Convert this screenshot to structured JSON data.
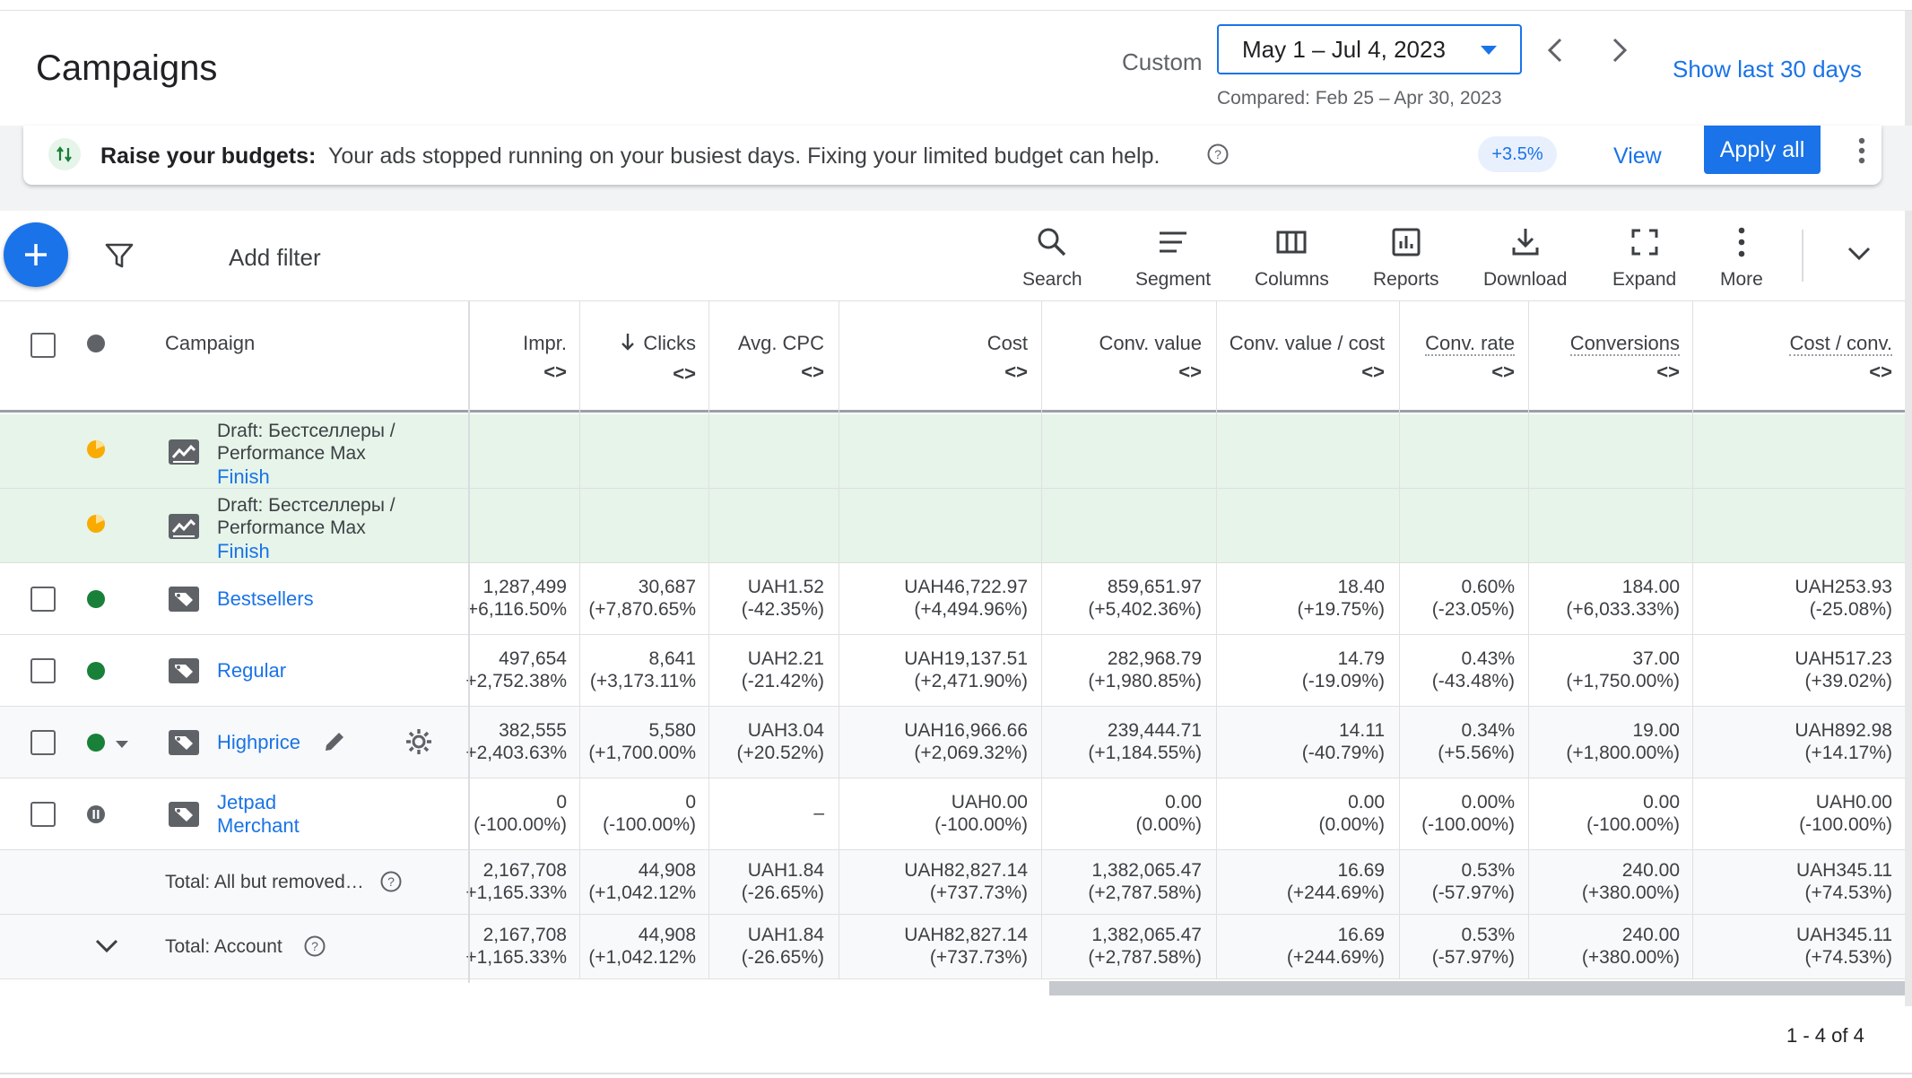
{
  "header": {
    "title": "Campaigns",
    "custom_label": "Custom",
    "date_range": "May 1 – Jul 4, 2023",
    "compared": "Compared: Feb 25 – Apr 30, 2023",
    "show_last": "Show last 30 days"
  },
  "banner": {
    "title": "Raise your budgets:",
    "text": "Your ads stopped running on your busiest days. Fixing your limited budget can help.",
    "chip": "+3.5%",
    "view": "View",
    "apply": "Apply all"
  },
  "toolbar": {
    "add_filter": "Add filter",
    "tools": [
      "Search",
      "Segment",
      "Columns",
      "Reports",
      "Download",
      "Expand",
      "More"
    ]
  },
  "table": {
    "headers": {
      "campaign": "Campaign",
      "impr": "Impr.",
      "clicks": "Clicks",
      "avg_cpc": "Avg. CPC",
      "cost": "Cost",
      "conv_value": "Conv. value",
      "conv_value_cost": "Conv. value / cost",
      "conv_rate": "Conv. rate",
      "conversions": "Conversions",
      "cost_conv": "Cost / conv.",
      "sort_arrows": "<>"
    },
    "drafts": [
      {
        "line1": "Draft: Бестселлеры /",
        "line2": "Performance Max",
        "link": "Finish"
      },
      {
        "line1": "Draft: Бестселлеры /",
        "line2": "Performance Max",
        "link": "Finish"
      }
    ],
    "rows": [
      {
        "name": "Bestsellers",
        "impr": "1,287,499",
        "impr_d": "+6,116.50%",
        "clicks": "30,687",
        "clicks_d": "(+7,870.65%",
        "cpc": "UAH1.52",
        "cpc_d": "(-42.35%)",
        "cost": "UAH46,722.97",
        "cost_d": "(+4,494.96%)",
        "cv": "859,651.97",
        "cv_d": "(+5,402.36%)",
        "cvc": "18.40",
        "cvc_d": "(+19.75%)",
        "cr": "0.60%",
        "cr_d": "(-23.05%)",
        "conv": "184.00",
        "conv_d": "(+6,033.33%)",
        "cpconv": "UAH253.93",
        "cpconv_d": "(-25.08%)"
      },
      {
        "name": "Regular",
        "impr": "497,654",
        "impr_d": "+2,752.38%",
        "clicks": "8,641",
        "clicks_d": "(+3,173.11%",
        "cpc": "UAH2.21",
        "cpc_d": "(-21.42%)",
        "cost": "UAH19,137.51",
        "cost_d": "(+2,471.90%)",
        "cv": "282,968.79",
        "cv_d": "(+1,980.85%)",
        "cvc": "14.79",
        "cvc_d": "(-19.09%)",
        "cr": "0.43%",
        "cr_d": "(-43.48%)",
        "conv": "37.00",
        "conv_d": "(+1,750.00%)",
        "cpconv": "UAH517.23",
        "cpconv_d": "(+39.02%)"
      },
      {
        "name": "Highprice",
        "impr": "382,555",
        "impr_d": "+2,403.63%",
        "clicks": "5,580",
        "clicks_d": "(+1,700.00%",
        "cpc": "UAH3.04",
        "cpc_d": "(+20.52%)",
        "cost": "UAH16,966.66",
        "cost_d": "(+2,069.32%)",
        "cv": "239,444.71",
        "cv_d": "(+1,184.55%)",
        "cvc": "14.11",
        "cvc_d": "(-40.79%)",
        "cr": "0.34%",
        "cr_d": "(+5.56%)",
        "conv": "19.00",
        "conv_d": "(+1,800.00%)",
        "cpconv": "UAH892.98",
        "cpconv_d": "(+14.17%)"
      },
      {
        "name_line1": "Jetpad",
        "name_line2": "Merchant",
        "impr": "0",
        "impr_d": "(-100.00%)",
        "clicks": "0",
        "clicks_d": "(-100.00%)",
        "cpc": "–",
        "cost": "UAH0.00",
        "cost_d": "(-100.00%)",
        "cv": "0.00",
        "cv_d": "(0.00%)",
        "cvc": "0.00",
        "cvc_d": "(0.00%)",
        "cr": "0.00%",
        "cr_d": "(-100.00%)",
        "conv": "0.00",
        "conv_d": "(-100.00%)",
        "cpconv": "UAH0.00",
        "cpconv_d": "(-100.00%)"
      }
    ],
    "totals": [
      {
        "label": "Total: All but removed…",
        "impr": "2,167,708",
        "impr_d": "+1,165.33%",
        "clicks": "44,908",
        "clicks_d": "(+1,042.12%",
        "cpc": "UAH1.84",
        "cpc_d": "(-26.65%)",
        "cost": "UAH82,827.14",
        "cost_d": "(+737.73%)",
        "cv": "1,382,065.47",
        "cv_d": "(+2,787.58%)",
        "cvc": "16.69",
        "cvc_d": "(+244.69%)",
        "cr": "0.53%",
        "cr_d": "(-57.97%)",
        "conv": "240.00",
        "conv_d": "(+380.00%)",
        "cpconv": "UAH345.11",
        "cpconv_d": "(+74.53%)"
      },
      {
        "label": "Total: Account",
        "impr": "2,167,708",
        "impr_d": "+1,165.33%",
        "clicks": "44,908",
        "clicks_d": "(+1,042.12%",
        "cpc": "UAH1.84",
        "cpc_d": "(-26.65%)",
        "cost": "UAH82,827.14",
        "cost_d": "(+737.73%)",
        "cv": "1,382,065.47",
        "cv_d": "(+2,787.58%)",
        "cvc": "16.69",
        "cvc_d": "(+244.69%)",
        "cr": "0.53%",
        "cr_d": "(-57.97%)",
        "conv": "240.00",
        "conv_d": "(+380.00%)",
        "cpconv": "UAH345.11",
        "cpconv_d": "(+74.53%)"
      }
    ]
  },
  "pager": "1 - 4 of 4",
  "colors": {
    "accent": "#1a73e8",
    "enabled": "#188038",
    "draft": "#f9ab00",
    "draft_row": "#e6f4ea"
  }
}
